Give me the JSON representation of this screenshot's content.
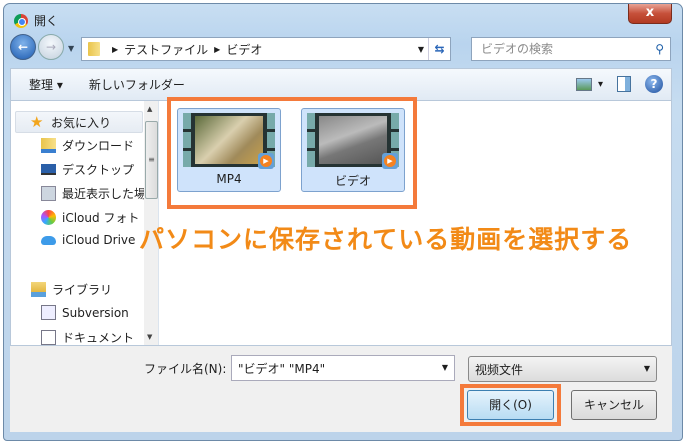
{
  "window": {
    "title": "開く",
    "close": "x"
  },
  "nav": {
    "back": "back",
    "forward": "forward",
    "breadcrumb": [
      "テストファイル",
      "ビデオ"
    ],
    "search_placeholder": "ビデオの検索"
  },
  "toolbar": {
    "organize": "整理 ▾",
    "new_folder": "新しいフォルダー",
    "view_dd": "▾",
    "help": "?"
  },
  "sidebar": {
    "items": [
      {
        "label": "お気に入り",
        "icon": "star-icon"
      },
      {
        "label": "ダウンロード",
        "icon": "download-folder-icon"
      },
      {
        "label": "デスクトップ",
        "icon": "desktop-icon"
      },
      {
        "label": "最近表示した場所",
        "icon": "recent-places-icon"
      },
      {
        "label": "iCloud フォト",
        "icon": "icloud-photos-icon"
      },
      {
        "label": "iCloud Drive",
        "icon": "icloud-drive-icon"
      },
      {
        "label": "ライブラリ",
        "icon": "library-icon"
      },
      {
        "label": "Subversion",
        "icon": "document-icon"
      },
      {
        "label": "ドキュメント",
        "icon": "document-icon"
      }
    ]
  },
  "files": [
    {
      "name": "MP4",
      "icon": "video-file-icon"
    },
    {
      "name": "ビデオ",
      "icon": "video-file-icon"
    }
  ],
  "annotation": "パソコンに保存されている動画を選択する",
  "bottom": {
    "filename_label": "ファイル名(N):",
    "filename_value": "\"ビデオ\" \"MP4\"",
    "filetype": "视频文件",
    "open": "開く(O)",
    "cancel": "キャンセル"
  },
  "colors": {
    "highlight": "#f47a3b",
    "annotation": "#f28a17"
  }
}
